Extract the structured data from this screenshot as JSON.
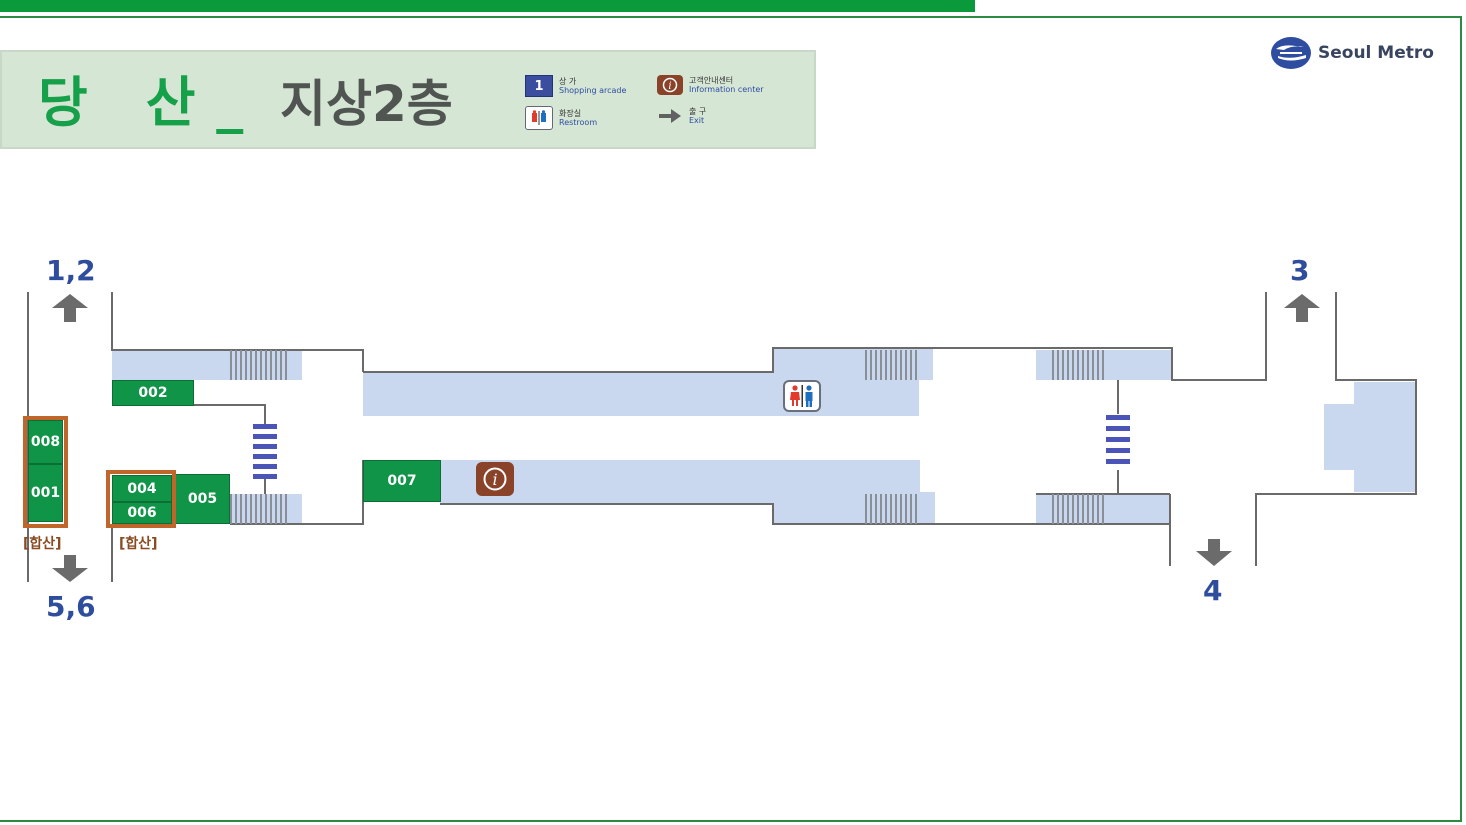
{
  "header": {
    "station_part1": "당",
    "station_part2": "산",
    "underscore": "_",
    "floor": "지상2층"
  },
  "legend": {
    "shopping_number": "1",
    "shopping_ko": "상 가",
    "shopping_en": "Shopping arcade",
    "info_ko": "고객안내센터",
    "info_en": "Information center",
    "restroom_ko": "화장실",
    "restroom_en": "Restroom",
    "exit_ko": "출 구",
    "exit_en": "Exit"
  },
  "logo": {
    "text": "Seoul Metro"
  },
  "exits": {
    "e12": "1,2",
    "e56": "5,6",
    "e3": "3",
    "e4": "4"
  },
  "shops": {
    "s002": "002",
    "s008": "008",
    "s001": "001",
    "s004": "004",
    "s006": "006",
    "s005": "005",
    "s007": "007"
  },
  "combined": {
    "left": "[합산]",
    "right": "[합산]"
  },
  "colors": {
    "shop_green": "#109448",
    "corridor_blue": "#c9d8ee",
    "exit_blue": "#2e4d9c",
    "combined_outline": "#c0662a",
    "info_brown": "#8a4329"
  },
  "icons": [
    "seoul-metro-logo-icon",
    "shopping-arcade-icon",
    "information-center-icon",
    "restroom-icon",
    "exit-arrow-icon",
    "stairs-icon",
    "escalator-icon"
  ]
}
